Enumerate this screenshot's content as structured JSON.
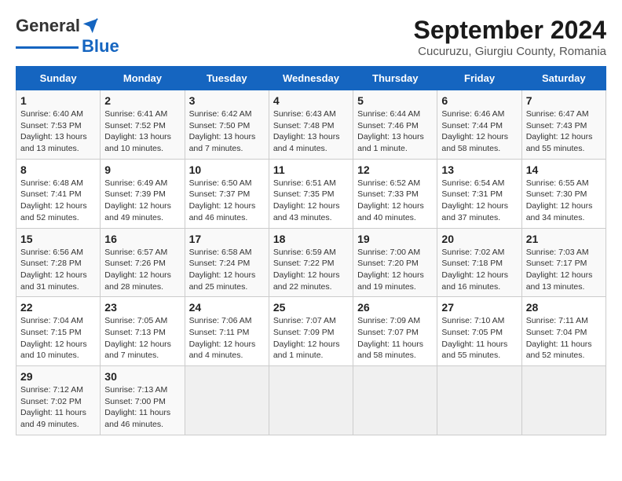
{
  "header": {
    "logo_general": "General",
    "logo_blue": "Blue",
    "title": "September 2024",
    "subtitle": "Cucuruzu, Giurgiu County, Romania"
  },
  "weekdays": [
    "Sunday",
    "Monday",
    "Tuesday",
    "Wednesday",
    "Thursday",
    "Friday",
    "Saturday"
  ],
  "weeks": [
    [
      {
        "day": "1",
        "content": "Sunrise: 6:40 AM\nSunset: 7:53 PM\nDaylight: 13 hours\nand 13 minutes."
      },
      {
        "day": "2",
        "content": "Sunrise: 6:41 AM\nSunset: 7:52 PM\nDaylight: 13 hours\nand 10 minutes."
      },
      {
        "day": "3",
        "content": "Sunrise: 6:42 AM\nSunset: 7:50 PM\nDaylight: 13 hours\nand 7 minutes."
      },
      {
        "day": "4",
        "content": "Sunrise: 6:43 AM\nSunset: 7:48 PM\nDaylight: 13 hours\nand 4 minutes."
      },
      {
        "day": "5",
        "content": "Sunrise: 6:44 AM\nSunset: 7:46 PM\nDaylight: 13 hours\nand 1 minute."
      },
      {
        "day": "6",
        "content": "Sunrise: 6:46 AM\nSunset: 7:44 PM\nDaylight: 12 hours\nand 58 minutes."
      },
      {
        "day": "7",
        "content": "Sunrise: 6:47 AM\nSunset: 7:43 PM\nDaylight: 12 hours\nand 55 minutes."
      }
    ],
    [
      {
        "day": "8",
        "content": "Sunrise: 6:48 AM\nSunset: 7:41 PM\nDaylight: 12 hours\nand 52 minutes."
      },
      {
        "day": "9",
        "content": "Sunrise: 6:49 AM\nSunset: 7:39 PM\nDaylight: 12 hours\nand 49 minutes."
      },
      {
        "day": "10",
        "content": "Sunrise: 6:50 AM\nSunset: 7:37 PM\nDaylight: 12 hours\nand 46 minutes."
      },
      {
        "day": "11",
        "content": "Sunrise: 6:51 AM\nSunset: 7:35 PM\nDaylight: 12 hours\nand 43 minutes."
      },
      {
        "day": "12",
        "content": "Sunrise: 6:52 AM\nSunset: 7:33 PM\nDaylight: 12 hours\nand 40 minutes."
      },
      {
        "day": "13",
        "content": "Sunrise: 6:54 AM\nSunset: 7:31 PM\nDaylight: 12 hours\nand 37 minutes."
      },
      {
        "day": "14",
        "content": "Sunrise: 6:55 AM\nSunset: 7:30 PM\nDaylight: 12 hours\nand 34 minutes."
      }
    ],
    [
      {
        "day": "15",
        "content": "Sunrise: 6:56 AM\nSunset: 7:28 PM\nDaylight: 12 hours\nand 31 minutes."
      },
      {
        "day": "16",
        "content": "Sunrise: 6:57 AM\nSunset: 7:26 PM\nDaylight: 12 hours\nand 28 minutes."
      },
      {
        "day": "17",
        "content": "Sunrise: 6:58 AM\nSunset: 7:24 PM\nDaylight: 12 hours\nand 25 minutes."
      },
      {
        "day": "18",
        "content": "Sunrise: 6:59 AM\nSunset: 7:22 PM\nDaylight: 12 hours\nand 22 minutes."
      },
      {
        "day": "19",
        "content": "Sunrise: 7:00 AM\nSunset: 7:20 PM\nDaylight: 12 hours\nand 19 minutes."
      },
      {
        "day": "20",
        "content": "Sunrise: 7:02 AM\nSunset: 7:18 PM\nDaylight: 12 hours\nand 16 minutes."
      },
      {
        "day": "21",
        "content": "Sunrise: 7:03 AM\nSunset: 7:17 PM\nDaylight: 12 hours\nand 13 minutes."
      }
    ],
    [
      {
        "day": "22",
        "content": "Sunrise: 7:04 AM\nSunset: 7:15 PM\nDaylight: 12 hours\nand 10 minutes."
      },
      {
        "day": "23",
        "content": "Sunrise: 7:05 AM\nSunset: 7:13 PM\nDaylight: 12 hours\nand 7 minutes."
      },
      {
        "day": "24",
        "content": "Sunrise: 7:06 AM\nSunset: 7:11 PM\nDaylight: 12 hours\nand 4 minutes."
      },
      {
        "day": "25",
        "content": "Sunrise: 7:07 AM\nSunset: 7:09 PM\nDaylight: 12 hours\nand 1 minute."
      },
      {
        "day": "26",
        "content": "Sunrise: 7:09 AM\nSunset: 7:07 PM\nDaylight: 11 hours\nand 58 minutes."
      },
      {
        "day": "27",
        "content": "Sunrise: 7:10 AM\nSunset: 7:05 PM\nDaylight: 11 hours\nand 55 minutes."
      },
      {
        "day": "28",
        "content": "Sunrise: 7:11 AM\nSunset: 7:04 PM\nDaylight: 11 hours\nand 52 minutes."
      }
    ],
    [
      {
        "day": "29",
        "content": "Sunrise: 7:12 AM\nSunset: 7:02 PM\nDaylight: 11 hours\nand 49 minutes."
      },
      {
        "day": "30",
        "content": "Sunrise: 7:13 AM\nSunset: 7:00 PM\nDaylight: 11 hours\nand 46 minutes."
      },
      {
        "day": "",
        "content": ""
      },
      {
        "day": "",
        "content": ""
      },
      {
        "day": "",
        "content": ""
      },
      {
        "day": "",
        "content": ""
      },
      {
        "day": "",
        "content": ""
      }
    ]
  ]
}
